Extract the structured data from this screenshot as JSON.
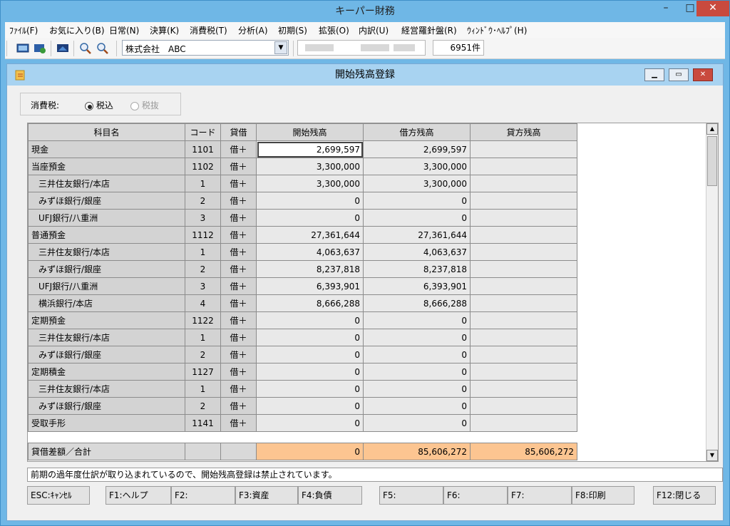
{
  "app": {
    "title": "キーパー財務"
  },
  "window_controls": {
    "minimize": "–",
    "maximize": "□",
    "close": "✕"
  },
  "menu": [
    "ﾌｧｲﾙ(F)",
    "お気に入り(B)",
    "日常(N)",
    "決算(K)",
    "消費税(T)",
    "分析(A)",
    "初期(S)",
    "拡張(O)",
    "内訳(U)",
    "経営羅針盤(R)",
    "ｳｨﾝﾄﾞｳ･ﾍﾙﾌﾟ(H)"
  ],
  "toolbar": {
    "company": "株式会社　ABC",
    "count": "6951件"
  },
  "dialog": {
    "title": "開始残高登録",
    "tax_label": "消費税:",
    "tax_incl": "税込",
    "tax_excl": "税抜"
  },
  "table": {
    "headers": [
      "科目名",
      "コード",
      "貸借",
      "開始残高",
      "借方残高",
      "貸方残高"
    ],
    "rows": [
      {
        "name": "現金",
        "code": "1101",
        "side": "借＋",
        "open": "2,699,597",
        "debit": "2,699,597",
        "credit": ""
      },
      {
        "name": "当座預金",
        "code": "1102",
        "side": "借＋",
        "open": "3,300,000",
        "debit": "3,300,000",
        "credit": ""
      },
      {
        "name": "三井住友銀行/本店",
        "code": "1",
        "side": "借＋",
        "open": "3,300,000",
        "debit": "3,300,000",
        "credit": ""
      },
      {
        "name": "みずほ銀行/銀座",
        "code": "2",
        "side": "借＋",
        "open": "0",
        "debit": "0",
        "credit": ""
      },
      {
        "name": "UFJ銀行/八重洲",
        "code": "3",
        "side": "借＋",
        "open": "0",
        "debit": "0",
        "credit": ""
      },
      {
        "name": "普通預金",
        "code": "1112",
        "side": "借＋",
        "open": "27,361,644",
        "debit": "27,361,644",
        "credit": ""
      },
      {
        "name": "三井住友銀行/本店",
        "code": "1",
        "side": "借＋",
        "open": "4,063,637",
        "debit": "4,063,637",
        "credit": ""
      },
      {
        "name": "みずほ銀行/銀座",
        "code": "2",
        "side": "借＋",
        "open": "8,237,818",
        "debit": "8,237,818",
        "credit": ""
      },
      {
        "name": "UFJ銀行/八重洲",
        "code": "3",
        "side": "借＋",
        "open": "6,393,901",
        "debit": "6,393,901",
        "credit": ""
      },
      {
        "name": "横浜銀行/本店",
        "code": "4",
        "side": "借＋",
        "open": "8,666,288",
        "debit": "8,666,288",
        "credit": ""
      },
      {
        "name": "定期預金",
        "code": "1122",
        "side": "借＋",
        "open": "0",
        "debit": "0",
        "credit": ""
      },
      {
        "name": "三井住友銀行/本店",
        "code": "1",
        "side": "借＋",
        "open": "0",
        "debit": "0",
        "credit": ""
      },
      {
        "name": "みずほ銀行/銀座",
        "code": "2",
        "side": "借＋",
        "open": "0",
        "debit": "0",
        "credit": ""
      },
      {
        "name": "定期積金",
        "code": "1127",
        "side": "借＋",
        "open": "0",
        "debit": "0",
        "credit": ""
      },
      {
        "name": "三井住友銀行/本店",
        "code": "1",
        "side": "借＋",
        "open": "0",
        "debit": "0",
        "credit": ""
      },
      {
        "name": "みずほ銀行/銀座",
        "code": "2",
        "side": "借＋",
        "open": "0",
        "debit": "0",
        "credit": ""
      },
      {
        "name": "受取手形",
        "code": "1141",
        "side": "借＋",
        "open": "0",
        "debit": "0",
        "credit": ""
      }
    ],
    "footer": {
      "label": "貸借差額／合計",
      "open": "0",
      "debit": "85,606,272",
      "credit": "85,606,272"
    }
  },
  "message": "前期の過年度仕訳が取り込まれているので、開始残高登録は禁止されています。",
  "fkeys": [
    "ESC:ｷｬﾝｾﾙ",
    "F1:ヘルプ",
    "F2:",
    "F3:資産",
    "F4:負債",
    "F5:",
    "F6:",
    "F7:",
    "F8:印刷",
    "F12:閉じる"
  ]
}
